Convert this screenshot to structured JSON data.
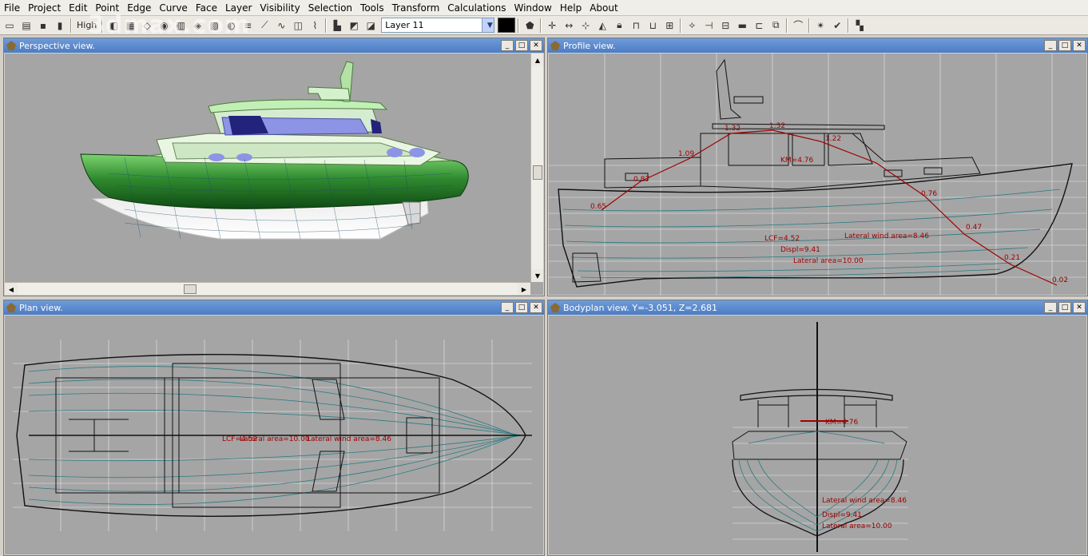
{
  "menu": [
    "File",
    "Project",
    "Edit",
    "Point",
    "Edge",
    "Curve",
    "Face",
    "Layer",
    "Visibility",
    "Selection",
    "Tools",
    "Transform",
    "Calculations",
    "Window",
    "Help",
    "About"
  ],
  "toolbar": {
    "precision_label": "High",
    "layer_value": "Layer 11"
  },
  "watermark": "3dmax.com",
  "views": {
    "perspective": {
      "title": "Perspective view."
    },
    "profile": {
      "title": "Profile view."
    },
    "plan": {
      "title": "Plan view."
    },
    "bodyplan": {
      "title": "Bodyplan view.  Y=-3.051,  Z=2.681"
    }
  },
  "profile_labels": {
    "curve_points": [
      "0.65",
      "0.87",
      "1.09",
      "1.32",
      "1.32",
      "1.22",
      "0.76",
      "0.47",
      "0.21",
      "0.02"
    ],
    "km": "KM=4.76",
    "lcf": "LCF=4.52",
    "displ": "Displ=9.41",
    "lateral": "Lateral area=10.00",
    "lateral_wind": "Lateral wind area=8.46"
  },
  "plan_labels": {
    "lcf": "LCF=4.52",
    "lateral": "Lateral area=10.00",
    "lateral_wind": "Lateral wind area=8.46"
  },
  "body_labels": {
    "km": "KM=4.76",
    "lateral_wind": "Lateral wind area=8.46",
    "displ": "Displ=9.41",
    "lateral": "Lateral area=10.00"
  },
  "colors": {
    "hull_green": "#2f8a2f",
    "wireframe": "#2a7a80",
    "annotation_red": "#b00000",
    "titlebar_blue": "#5a88cf"
  }
}
